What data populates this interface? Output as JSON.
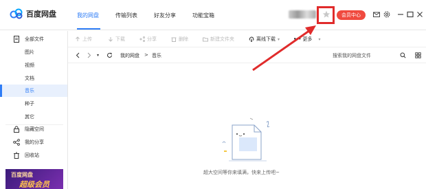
{
  "app": {
    "logo_text": "百度网盘"
  },
  "nav": {
    "items": [
      {
        "label": "我的网盘",
        "active": true
      },
      {
        "label": "传输列表",
        "active": false
      },
      {
        "label": "好友分享",
        "active": false
      },
      {
        "label": "功能宝箱",
        "active": false
      }
    ]
  },
  "header": {
    "vip_label": "会员中心",
    "icons": [
      "mail-icon",
      "settings-icon",
      "minimize-icon",
      "maximize-icon",
      "close-icon"
    ]
  },
  "toolbar": {
    "upload": "上传",
    "download": "下载",
    "share": "分享",
    "delete": "删除",
    "new_folder": "新建文件夹",
    "offline_download": "离线下载",
    "more": "更多"
  },
  "address": {
    "crumbs": [
      "我的网盘",
      ">",
      "音乐"
    ],
    "search_placeholder": "搜索我的网盘文件"
  },
  "sidebar": {
    "items": [
      {
        "label": "全部文件",
        "type": "top",
        "icon": "file-icon"
      },
      {
        "label": "图片",
        "type": "sub"
      },
      {
        "label": "视频",
        "type": "sub"
      },
      {
        "label": "文档",
        "type": "sub"
      },
      {
        "label": "音乐",
        "type": "sub",
        "active": true
      },
      {
        "label": "种子",
        "type": "sub"
      },
      {
        "label": "其它",
        "type": "sub"
      },
      {
        "label": "隐藏空间",
        "type": "top",
        "icon": "lock-icon"
      },
      {
        "label": "我的分享",
        "type": "top",
        "icon": "share-icon"
      },
      {
        "label": "回收站",
        "type": "top",
        "icon": "trash-icon"
      }
    ],
    "promo": {
      "line1": "百度网盘",
      "line2": "超级会员"
    }
  },
  "main": {
    "empty_text": "超大空间等你来填满，快来上传吧~"
  },
  "colors": {
    "accent": "#2f7df6",
    "vip": "#f04a3f",
    "annotation": "#e02b2b"
  }
}
